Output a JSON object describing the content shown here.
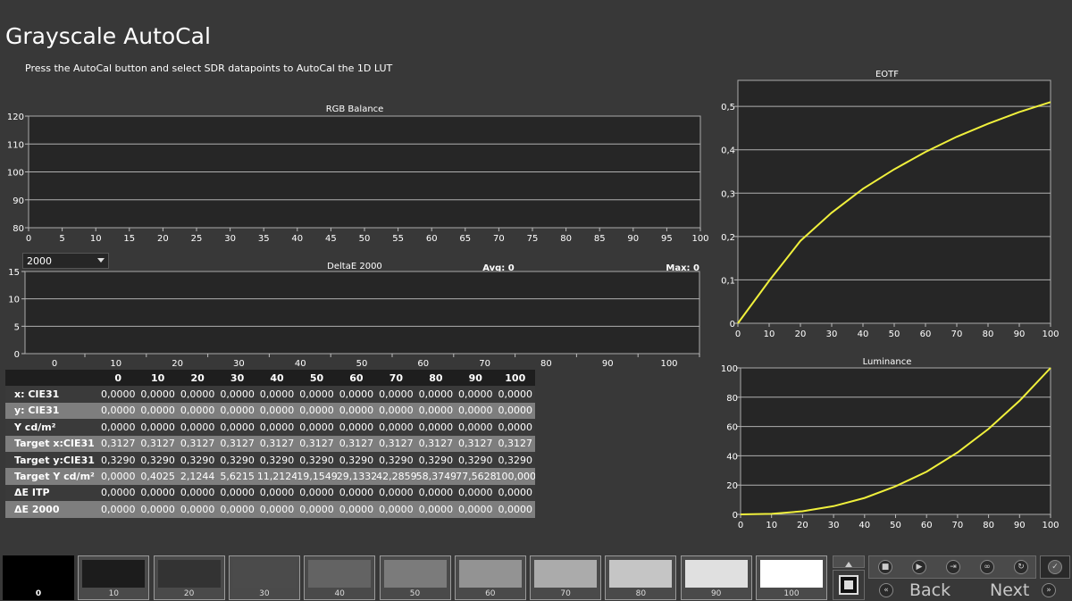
{
  "title": "Grayscale AutoCal",
  "instructions": "Press the AutoCal button and select SDR datapoints to AutoCal the 1D LUT",
  "rgb_chart": {
    "title": "RGB Balance",
    "y_ticks": [
      "120",
      "110",
      "100",
      "90",
      "80"
    ],
    "x_ticks": [
      "0",
      "5",
      "10",
      "15",
      "20",
      "25",
      "30",
      "35",
      "40",
      "45",
      "50",
      "55",
      "60",
      "65",
      "70",
      "75",
      "80",
      "85",
      "90",
      "95",
      "100"
    ]
  },
  "delta_chart": {
    "title": "DeltaE 2000",
    "avg_label": "Avg: 0",
    "max_label": "Max: 0",
    "y_ticks": [
      "15",
      "10",
      "5",
      "0"
    ],
    "x_ticks": [
      "0",
      "10",
      "20",
      "30",
      "40",
      "50",
      "60",
      "70",
      "80",
      "90",
      "100"
    ]
  },
  "dropdown": {
    "selected": "2000"
  },
  "table": {
    "columns": [
      "0",
      "10",
      "20",
      "30",
      "40",
      "50",
      "60",
      "70",
      "80",
      "90",
      "100"
    ],
    "rows": [
      {
        "label": "x: CIE31",
        "values": [
          "0,0000",
          "0,0000",
          "0,0000",
          "0,0000",
          "0,0000",
          "0,0000",
          "0,0000",
          "0,0000",
          "0,0000",
          "0,0000",
          "0,0000"
        ]
      },
      {
        "label": "y: CIE31",
        "values": [
          "0,0000",
          "0,0000",
          "0,0000",
          "0,0000",
          "0,0000",
          "0,0000",
          "0,0000",
          "0,0000",
          "0,0000",
          "0,0000",
          "0,0000"
        ]
      },
      {
        "label": "Y cd/m²",
        "values": [
          "0,0000",
          "0,0000",
          "0,0000",
          "0,0000",
          "0,0000",
          "0,0000",
          "0,0000",
          "0,0000",
          "0,0000",
          "0,0000",
          "0,0000"
        ]
      },
      {
        "label": "Target x:CIE31",
        "values": [
          "0,3127",
          "0,3127",
          "0,3127",
          "0,3127",
          "0,3127",
          "0,3127",
          "0,3127",
          "0,3127",
          "0,3127",
          "0,3127",
          "0,3127"
        ]
      },
      {
        "label": "Target y:CIE31",
        "values": [
          "0,3290",
          "0,3290",
          "0,3290",
          "0,3290",
          "0,3290",
          "0,3290",
          "0,3290",
          "0,3290",
          "0,3290",
          "0,3290",
          "0,3290"
        ]
      },
      {
        "label": "Target Y cd/m²",
        "values": [
          "0,0000",
          "0,4025",
          "2,1244",
          "5,6215",
          "11,2124",
          "19,1549",
          "29,1332",
          "42,2859",
          "58,3749",
          "77,5628",
          "100,0000"
        ]
      },
      {
        "label": "ΔE ITP",
        "values": [
          "0,0000",
          "0,0000",
          "0,0000",
          "0,0000",
          "0,0000",
          "0,0000",
          "0,0000",
          "0,0000",
          "0,0000",
          "0,0000",
          "0,0000"
        ]
      },
      {
        "label": "ΔE 2000",
        "values": [
          "0,0000",
          "0,0000",
          "0,0000",
          "0,0000",
          "0,0000",
          "0,0000",
          "0,0000",
          "0,0000",
          "0,0000",
          "0,0000",
          "0,0000"
        ]
      }
    ]
  },
  "chart_data": [
    {
      "type": "line",
      "title": "EOTF",
      "x": [
        0,
        10,
        20,
        30,
        40,
        50,
        60,
        70,
        80,
        90,
        100
      ],
      "series": [
        {
          "values": [
            0,
            0.098,
            0.19,
            0.255,
            0.31,
            0.355,
            0.395,
            0.43,
            0.46,
            0.487,
            0.51
          ],
          "color": "#f0f03c"
        }
      ],
      "x_ticks": [
        "0",
        "10",
        "20",
        "30",
        "40",
        "50",
        "60",
        "70",
        "80",
        "90",
        "100"
      ],
      "y_ticks": [
        "0",
        "0,1",
        "0,2",
        "0,3",
        "0,4",
        "0,5"
      ],
      "xlim": [
        0,
        100
      ],
      "ylim": [
        0,
        0.56
      ]
    },
    {
      "type": "line",
      "title": "Luminance",
      "x": [
        0,
        10,
        20,
        30,
        40,
        50,
        60,
        70,
        80,
        90,
        100
      ],
      "series": [
        {
          "values": [
            0,
            0.4025,
            2.1244,
            5.6215,
            11.2124,
            19.1549,
            29.1332,
            42.2859,
            58.3749,
            77.5628,
            100
          ],
          "color": "#f0f03c"
        }
      ],
      "x_ticks": [
        "0",
        "10",
        "20",
        "30",
        "40",
        "50",
        "60",
        "70",
        "80",
        "90",
        "100"
      ],
      "y_ticks": [
        "0",
        "20",
        "40",
        "60",
        "80",
        "100"
      ],
      "xlim": [
        0,
        100
      ],
      "ylim": [
        0,
        100
      ]
    }
  ],
  "swatches": [
    {
      "label": "0",
      "color": "#000000",
      "active": true
    },
    {
      "label": "10",
      "color": "#1c1c1c"
    },
    {
      "label": "20",
      "color": "#333333"
    },
    {
      "label": "30",
      "color": "#4b4b4b"
    },
    {
      "label": "40",
      "color": "#636363"
    },
    {
      "label": "50",
      "color": "#7b7b7b"
    },
    {
      "label": "60",
      "color": "#939393"
    },
    {
      "label": "70",
      "color": "#ababab"
    },
    {
      "label": "80",
      "color": "#c5c5c5"
    },
    {
      "label": "90",
      "color": "#e0e0e0"
    },
    {
      "label": "100",
      "color": "#ffffff"
    }
  ],
  "nav": {
    "back_label": "Back",
    "next_label": "Next"
  },
  "icons": [
    "scroll-up-icon",
    "stop-icon",
    "stop-round-icon",
    "play-icon",
    "step-icon",
    "loop-icon",
    "refresh-icon",
    "check-icon",
    "rewind-icon",
    "forward-icon"
  ]
}
